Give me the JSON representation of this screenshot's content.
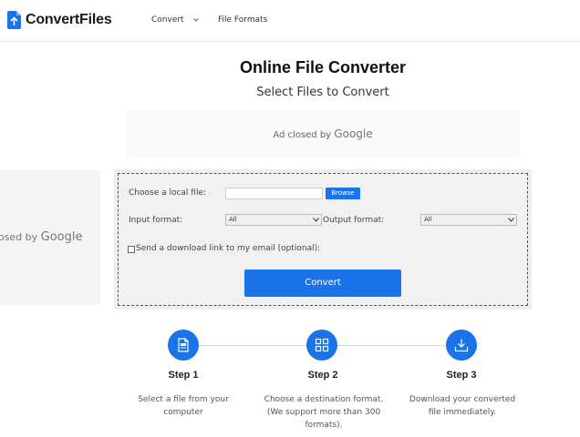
{
  "header": {
    "logo_text": "ConvertFiles",
    "nav": [
      {
        "label": "Convert",
        "has_dropdown": true
      },
      {
        "label": "File Formats",
        "has_dropdown": false
      }
    ]
  },
  "main": {
    "title": "Online File Converter",
    "subtitle": "Select Files to Convert"
  },
  "ads": {
    "top_text": "Ad closed by",
    "top_brand": "Google",
    "left_text": "Ad closed by",
    "left_brand": "Google"
  },
  "form": {
    "local_file_label": "Choose a local file:",
    "browse_label": "Browse",
    "input_format_label": "Input format:",
    "input_format_value": "All",
    "output_format_label": "Output format:",
    "output_format_value": "All",
    "email_checkbox_label": "Send a download link to my email (optional):",
    "convert_label": "Convert"
  },
  "steps": [
    {
      "title": "Step 1",
      "desc": "Select a file from your computer",
      "icon": "file-icon"
    },
    {
      "title": "Step 2",
      "desc": "Choose a destination format. (We support more than 300 formats).",
      "icon": "grid-icon"
    },
    {
      "title": "Step 3",
      "desc": "Download your converted file immediately.",
      "icon": "download-icon"
    }
  ],
  "colors": {
    "accent": "#1a73e8",
    "panel_bg": "#eeeeee"
  }
}
